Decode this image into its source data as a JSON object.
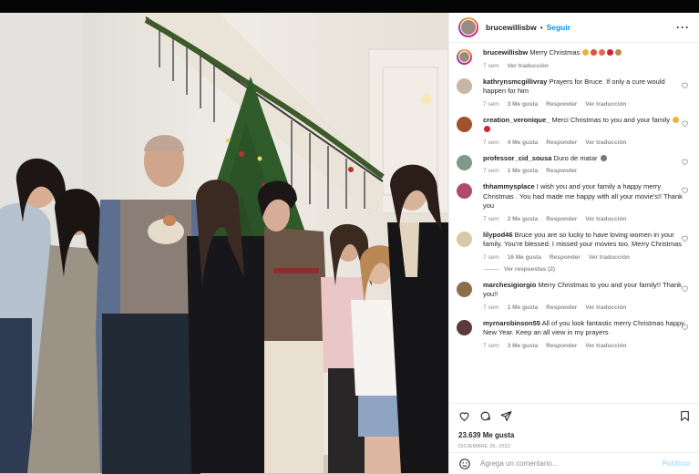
{
  "post": {
    "username": "brucewillisbw",
    "follow_label": "Seguir",
    "more_icon": "more-horizontal-icon",
    "photo_alt": "Family photo by the Christmas tree"
  },
  "caption": {
    "username": "brucewillisbw",
    "text": "Merry Christmas",
    "time": "7 sem",
    "translate": "Ver traducción"
  },
  "comments": [
    {
      "username": "kathrynsmcgillivray",
      "text": "Prayers for Bruce. If only a cure would happen for him",
      "time": "7 sem",
      "likes": "3 Me gusta",
      "reply": "Responder",
      "translate": "Ver traducción",
      "avatar_color": "#c9b7a6"
    },
    {
      "username": "creation_veronique_",
      "text": "Merci Christmas to you and your family",
      "time": "7 sem",
      "likes": "4 Me gusta",
      "reply": "Responder",
      "translate": "Ver traducción",
      "avatar_color": "#a0522d"
    },
    {
      "username": "professor_cid_sousa",
      "text": "Duro de matar",
      "time": "7 sem",
      "likes": "1 Me gusta",
      "reply": "Responder",
      "translate": "",
      "avatar_color": "#7f9a87"
    },
    {
      "username": "thhammysplace",
      "text": "I wish you and your family a happy merry Christmas . You had made me happy with all your movie's!! Thank you",
      "time": "7 sem",
      "likes": "2 Me gusta",
      "reply": "Responder",
      "translate": "Ver traducción",
      "avatar_color": "#b04a6a"
    },
    {
      "username": "lilypod46",
      "text": "Bruce you are so lucky to have loving women in your family. You're blessed. I missed your movies too. Merry Christmas",
      "time": "7 sem",
      "likes": "16 Me gusta",
      "reply": "Responder",
      "translate": "Ver traducción",
      "avatar_color": "#d8c8a8"
    },
    {
      "username": "marchesigiorgio",
      "text": "Merry Christmas to you and your family!! Thank you!!",
      "time": "7 sem",
      "likes": "1 Me gusta",
      "reply": "Responder",
      "translate": "Ver traducción",
      "avatar_color": "#8d6e4a"
    },
    {
      "username": "myrnarobinson55",
      "text": "All of you look fantastic merry Christmas happy New Year. Keep an all view in my prayers",
      "time": "7 sem",
      "likes": "3 Me gusta",
      "reply": "Responder",
      "translate": "Ver traducción",
      "avatar_color": "#5a3a3a"
    }
  ],
  "view_replies": "Ver respuestas (2)",
  "actions": {
    "like_icon": "heart-icon",
    "comment_icon": "comment-icon",
    "share_icon": "share-icon",
    "save_icon": "bookmark-icon"
  },
  "likes_count": "23.639 Me gusta",
  "post_date": "DICIEMBRE 25, 2022",
  "add_comment": {
    "placeholder": "Agrega un comentario...",
    "publish_label": "Publicar"
  },
  "colors": {
    "accent": "#0095f6",
    "muted": "#8e8e8e",
    "publish_disabled": "#b2dffc"
  }
}
